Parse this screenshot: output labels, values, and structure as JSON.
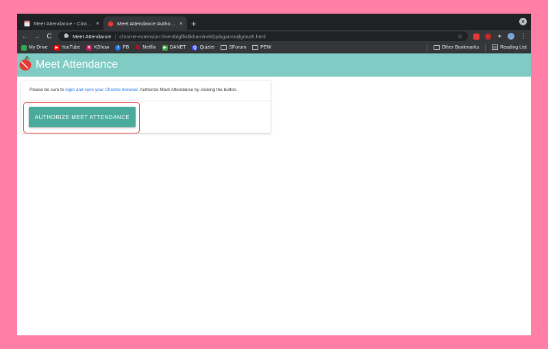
{
  "tabs": [
    {
      "title": "Meet Attendance - Cửa hàng C",
      "close": "×",
      "active": false
    },
    {
      "title": "Meet Attendance Authorize",
      "close": "×",
      "active": true
    }
  ],
  "new_tab": "+",
  "toolbar": {
    "back": "←",
    "forward": "→",
    "reload": "C",
    "site_name": "Meet Attendance",
    "separator": "|",
    "url": "chrome-extension://nenibigflkdikhamlnekfppbganmojlg/auth.html",
    "star": "☆",
    "menu": "⋮"
  },
  "bookmarks": {
    "items": [
      {
        "label": "My Drive",
        "icon": "drive-icon",
        "color": "#34a853"
      },
      {
        "label": "YouTube",
        "icon": "youtube-icon",
        "color": "#ff0000"
      },
      {
        "label": "KShow",
        "icon": "kshow-icon",
        "color": "#c2185b"
      },
      {
        "label": "FB",
        "icon": "facebook-icon",
        "color": "#1877f2"
      },
      {
        "label": "Netflix",
        "icon": "netflix-icon",
        "color": "#e50914"
      },
      {
        "label": "DANET",
        "icon": "danet-icon",
        "color": "#43a047"
      },
      {
        "label": "Quizlet",
        "icon": "quizlet-icon",
        "color": "#4255ff"
      },
      {
        "label": "SForum",
        "icon": "folder-icon",
        "color": "#bdc1c6"
      },
      {
        "label": "PEW",
        "icon": "folder-icon",
        "color": "#bdc1c6"
      }
    ],
    "other": "Other Bookmarks",
    "reading_list": "Reading List"
  },
  "app": {
    "title": "Meet Attendance",
    "header_color": "#80cbc4"
  },
  "card": {
    "text_before": "Please be sure to ",
    "link_text": "login and sync your Chrome browser",
    "text_after": ". Authorize Meet Attendance by clicking the button.",
    "button_label": "AUTHORIZE MEET ATTENDANCE",
    "button_color": "#4aab9c"
  }
}
